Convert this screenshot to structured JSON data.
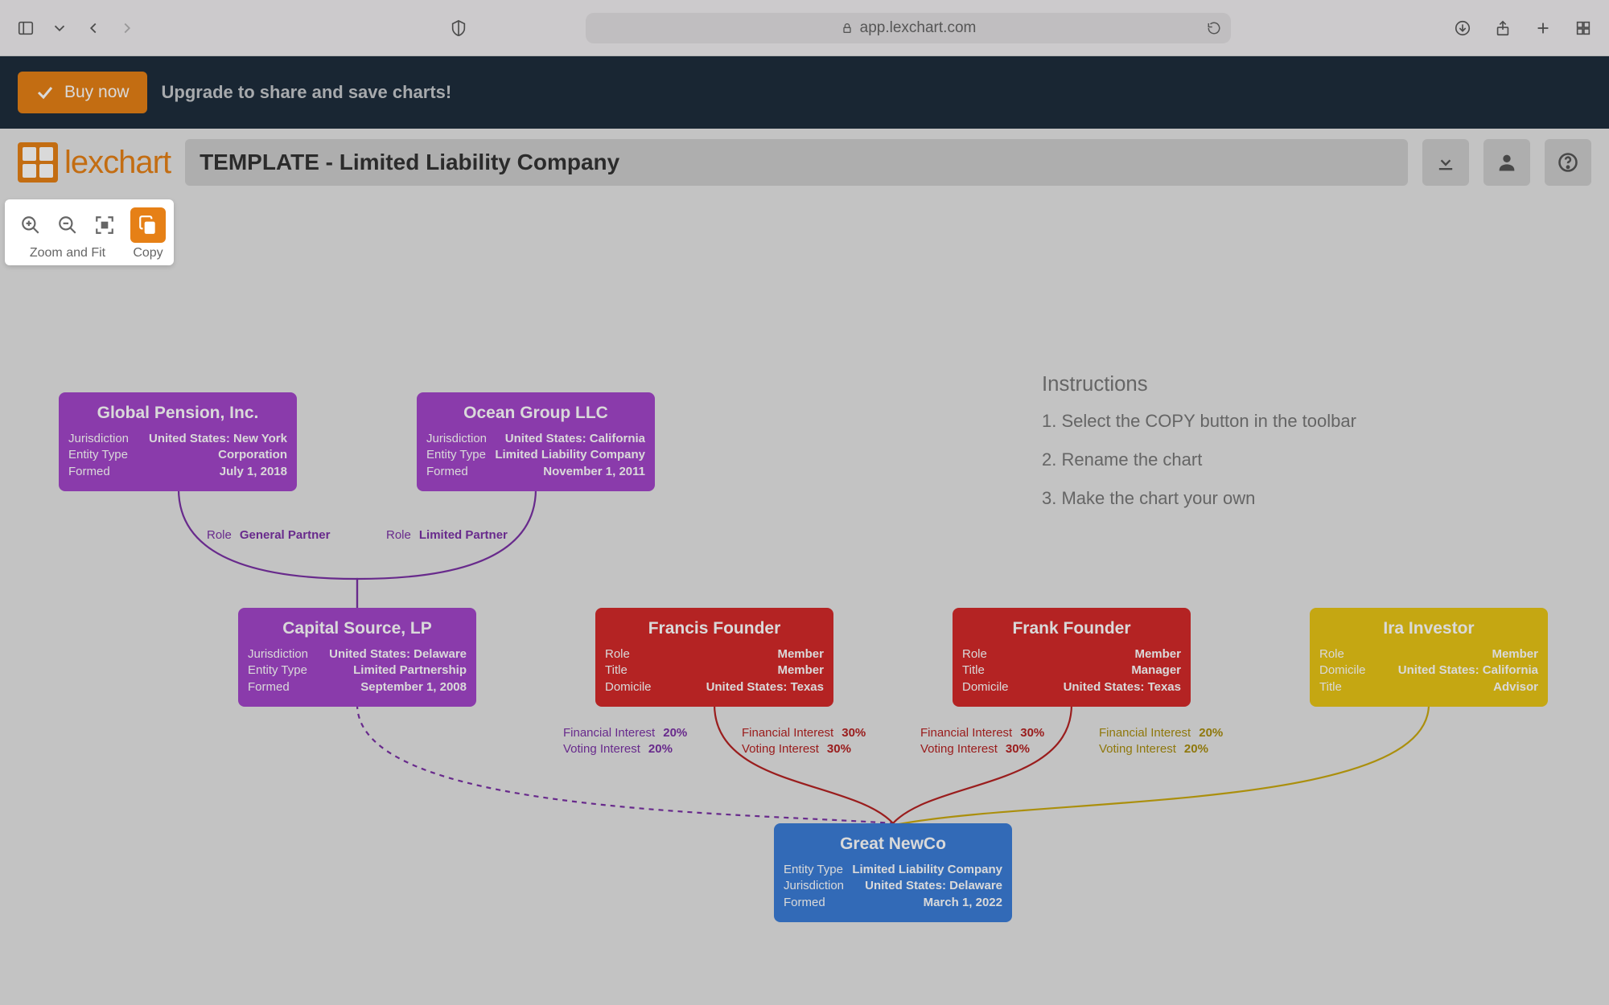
{
  "browser": {
    "url": "app.lexchart.com"
  },
  "upgrade": {
    "buy_label": "Buy now",
    "message": "Upgrade to share and save charts!"
  },
  "logo_text": "lexchart",
  "chart_title": "TEMPLATE - Limited Liability Company",
  "toolbar": {
    "zoom_label": "Zoom and Fit",
    "copy_label": "Copy"
  },
  "instructions": {
    "heading": "Instructions",
    "items": [
      "1. Select the COPY button in the toolbar",
      "2. Rename the chart",
      "3. Make the chart your own"
    ]
  },
  "entities": {
    "global_pension": {
      "name": "Global Pension, Inc.",
      "rows": [
        {
          "label": "Jurisdiction",
          "value": "United States: New York"
        },
        {
          "label": "Entity Type",
          "value": "Corporation"
        },
        {
          "label": "Formed",
          "value": "July 1, 2018"
        }
      ]
    },
    "ocean_group": {
      "name": "Ocean Group LLC",
      "rows": [
        {
          "label": "Jurisdiction",
          "value": "United States: California"
        },
        {
          "label": "Entity Type",
          "value": "Limited Liability Company"
        },
        {
          "label": "Formed",
          "value": "November 1, 2011"
        }
      ]
    },
    "capital_source": {
      "name": "Capital Source, LP",
      "rows": [
        {
          "label": "Jurisdiction",
          "value": "United States: Delaware"
        },
        {
          "label": "Entity Type",
          "value": "Limited Partnership"
        },
        {
          "label": "Formed",
          "value": "September 1, 2008"
        }
      ]
    },
    "francis": {
      "name": "Francis Founder",
      "rows": [
        {
          "label": "Role",
          "value": "Member"
        },
        {
          "label": "Title",
          "value": "Member"
        },
        {
          "label": "Domicile",
          "value": "United States: Texas"
        }
      ]
    },
    "frank": {
      "name": "Frank Founder",
      "rows": [
        {
          "label": "Role",
          "value": "Member"
        },
        {
          "label": "Title",
          "value": "Manager"
        },
        {
          "label": "Domicile",
          "value": "United States: Texas"
        }
      ]
    },
    "ira": {
      "name": "Ira Investor",
      "rows": [
        {
          "label": "Role",
          "value": "Member"
        },
        {
          "label": "Domicile",
          "value": "United States: California"
        },
        {
          "label": "Title",
          "value": "Advisor"
        }
      ]
    },
    "newco": {
      "name": "Great NewCo",
      "rows": [
        {
          "label": "Entity Type",
          "value": "Limited Liability Company"
        },
        {
          "label": "Jurisdiction",
          "value": "United States: Delaware"
        },
        {
          "label": "Formed",
          "value": "March 1, 2022"
        }
      ]
    }
  },
  "edges": {
    "gp_role_label": "Role",
    "gp_role_value": "General Partner",
    "lp_role_label": "Role",
    "lp_role_value": "Limited Partner",
    "capital": {
      "fi_label": "Financial Interest",
      "fi_value": "20%",
      "vi_label": "Voting Interest",
      "vi_value": "20%"
    },
    "francis": {
      "fi_label": "Financial Interest",
      "fi_value": "30%",
      "vi_label": "Voting Interest",
      "vi_value": "30%"
    },
    "frank": {
      "fi_label": "Financial Interest",
      "fi_value": "30%",
      "vi_label": "Voting Interest",
      "vi_value": "30%"
    },
    "ira": {
      "fi_label": "Financial Interest",
      "fi_value": "20%",
      "vi_label": "Voting Interest",
      "vi_value": "20%"
    }
  }
}
